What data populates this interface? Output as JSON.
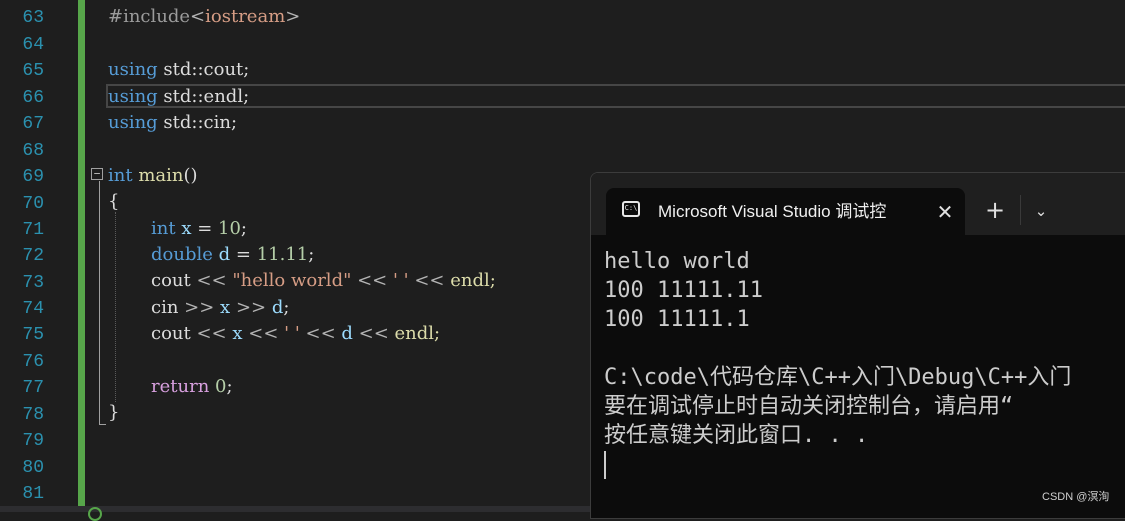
{
  "editor": {
    "line_numbers": [
      "63",
      "64",
      "65",
      "66",
      "67",
      "68",
      "69",
      "70",
      "71",
      "72",
      "73",
      "74",
      "75",
      "76",
      "77",
      "78",
      "79",
      "80",
      "81"
    ],
    "code": {
      "l63": {
        "pp": "#include",
        "op": "<",
        "text": "iostream",
        "close": ">"
      },
      "l65": {
        "kw": "using",
        "rest": " std::cout;"
      },
      "l66": {
        "kw": "using",
        "rest": " std::endl;"
      },
      "l67": {
        "kw": "using",
        "rest": " std::cin;"
      },
      "l69": {
        "kw": "int",
        "fn": "main",
        "rest": "()"
      },
      "l70": {
        "text": "{"
      },
      "l71": {
        "kw": "int",
        "var": "x",
        "eq": " = ",
        "num": "10",
        "end": ";"
      },
      "l72": {
        "kw": "double",
        "var": "d",
        "eq": " = ",
        "num": "11.11",
        "end": ";"
      },
      "l73": {
        "a": "cout ",
        "op1": "<<",
        "str1": " \"hello world\" ",
        "op2": "<<",
        "str2": " ' ' ",
        "op3": "<<",
        "b": " endl;"
      },
      "l74": {
        "a": "cin ",
        "op1": ">>",
        "var1": " x ",
        "op2": ">>",
        "var2": " d",
        "end": ";"
      },
      "l75": {
        "a": "cout ",
        "op1": "<<",
        "var1": " x ",
        "op2": "<<",
        "str1": " ' ' ",
        "op3": "<<",
        "var2": " d ",
        "op4": "<<",
        "b": " endl;"
      },
      "l77": {
        "kw": "return",
        "num": "0",
        "end": ";"
      },
      "l78": {
        "text": "}"
      }
    }
  },
  "terminal": {
    "tab_title": "Microsoft Visual Studio 调试控",
    "tab_icon_text": "C:\\",
    "close_icon": "✕",
    "new_tab_icon": "+",
    "dropdown_icon": "⌄",
    "output": [
      "hello world",
      "100 11111.11",
      "100 11111.1",
      "",
      "C:\\code\\代码仓库\\C++入门\\Debug\\C++入门",
      "要在调试停止时自动关闭控制台，请启用“",
      "按任意键关闭此窗口. . ."
    ]
  },
  "watermark": "CSDN @溟洵",
  "colors": {
    "keyword": "#569cd6",
    "string": "#d69d85",
    "number": "#b5cea8",
    "function": "#dcdcaa",
    "variable": "#9cdcfe",
    "return": "#d8a0df",
    "line_number": "#2b91af",
    "change_bar": "#57a64a"
  }
}
